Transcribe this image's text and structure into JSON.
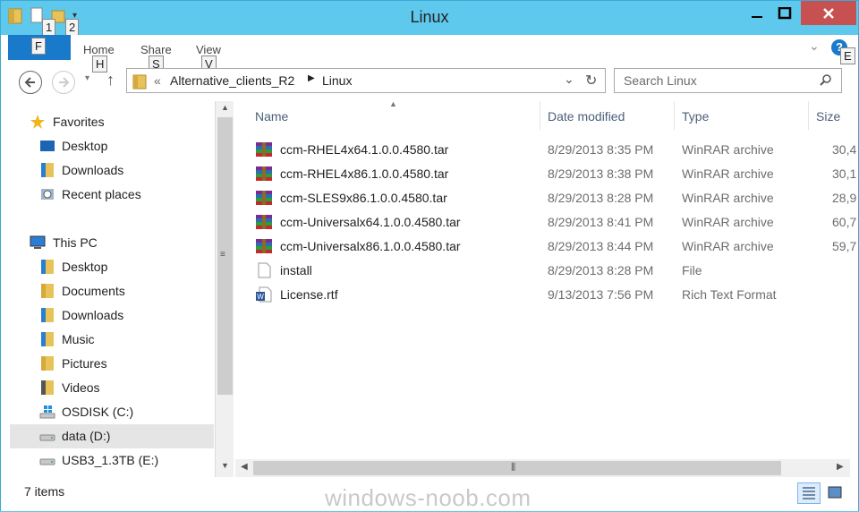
{
  "window": {
    "title": "Linux"
  },
  "qat": {
    "keytips": [
      "1",
      "2"
    ]
  },
  "ribbon": {
    "file_label": "F",
    "tabs": [
      {
        "label": "Home",
        "keytip": "H"
      },
      {
        "label": "Share",
        "keytip": "S"
      },
      {
        "label": "View",
        "keytip": "V"
      }
    ],
    "help_keytip": "E"
  },
  "address": {
    "overflow": "«",
    "crumbs": [
      "Alternative_clients_R2",
      "Linux"
    ]
  },
  "search": {
    "placeholder": "Search Linux"
  },
  "nav": {
    "favorites": {
      "label": "Favorites",
      "items": [
        "Desktop",
        "Downloads",
        "Recent places"
      ]
    },
    "thispc": {
      "label": "This PC",
      "items": [
        "Desktop",
        "Documents",
        "Downloads",
        "Music",
        "Pictures",
        "Videos",
        "OSDISK (C:)",
        "data (D:)",
        "USB3_1.3TB (E:)"
      ]
    }
  },
  "columns": {
    "name": "Name",
    "date": "Date modified",
    "type": "Type",
    "size": "Size"
  },
  "files": [
    {
      "name": "ccm-RHEL4x64.1.0.0.4580.tar",
      "date": "8/29/2013 8:35 PM",
      "type": "WinRAR archive",
      "size": "30,4",
      "icon": "winrar-icon"
    },
    {
      "name": "ccm-RHEL4x86.1.0.0.4580.tar",
      "date": "8/29/2013 8:38 PM",
      "type": "WinRAR archive",
      "size": "30,1",
      "icon": "winrar-icon"
    },
    {
      "name": "ccm-SLES9x86.1.0.0.4580.tar",
      "date": "8/29/2013 8:28 PM",
      "type": "WinRAR archive",
      "size": "28,9",
      "icon": "winrar-icon"
    },
    {
      "name": "ccm-Universalx64.1.0.0.4580.tar",
      "date": "8/29/2013 8:41 PM",
      "type": "WinRAR archive",
      "size": "60,7",
      "icon": "winrar-icon"
    },
    {
      "name": "ccm-Universalx86.1.0.0.4580.tar",
      "date": "8/29/2013 8:44 PM",
      "type": "WinRAR archive",
      "size": "59,7",
      "icon": "winrar-icon"
    },
    {
      "name": "install",
      "date": "8/29/2013 8:28 PM",
      "type": "File",
      "size": "",
      "icon": "file-icon"
    },
    {
      "name": "License.rtf",
      "date": "9/13/2013 7:56 PM",
      "type": "Rich Text Format",
      "size": "",
      "icon": "word-document-icon"
    }
  ],
  "status": {
    "count": "7 items"
  },
  "watermark": "windows-noob.com",
  "colors": {
    "titlebar": "#5ec9ec",
    "file_tab": "#1979ca",
    "close": "#c75050",
    "selected": "#e5e5e5"
  }
}
